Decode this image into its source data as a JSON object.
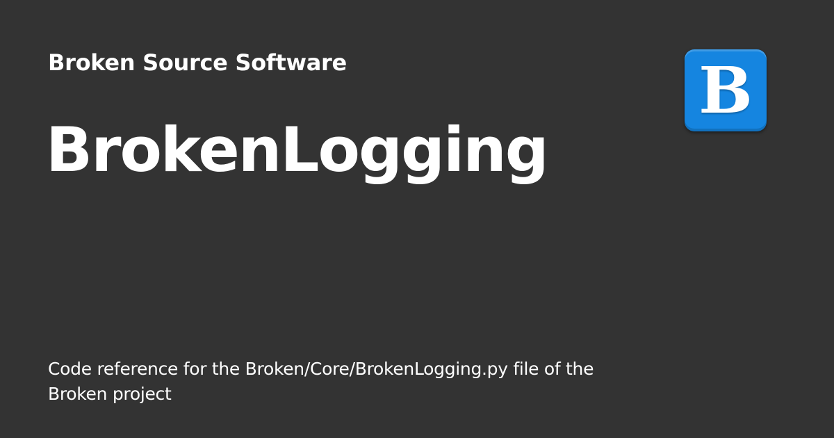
{
  "site": {
    "name": "Broken Source Software"
  },
  "page": {
    "title": "BrokenLogging",
    "description": "Code reference for the Broken/Core/BrokenLogging.py file of the Broken project"
  },
  "logo": {
    "letter": "B",
    "icon": "broken-logo-icon",
    "background_color": "#1585e0"
  },
  "colors": {
    "background": "#333333",
    "text": "#ffffff"
  }
}
